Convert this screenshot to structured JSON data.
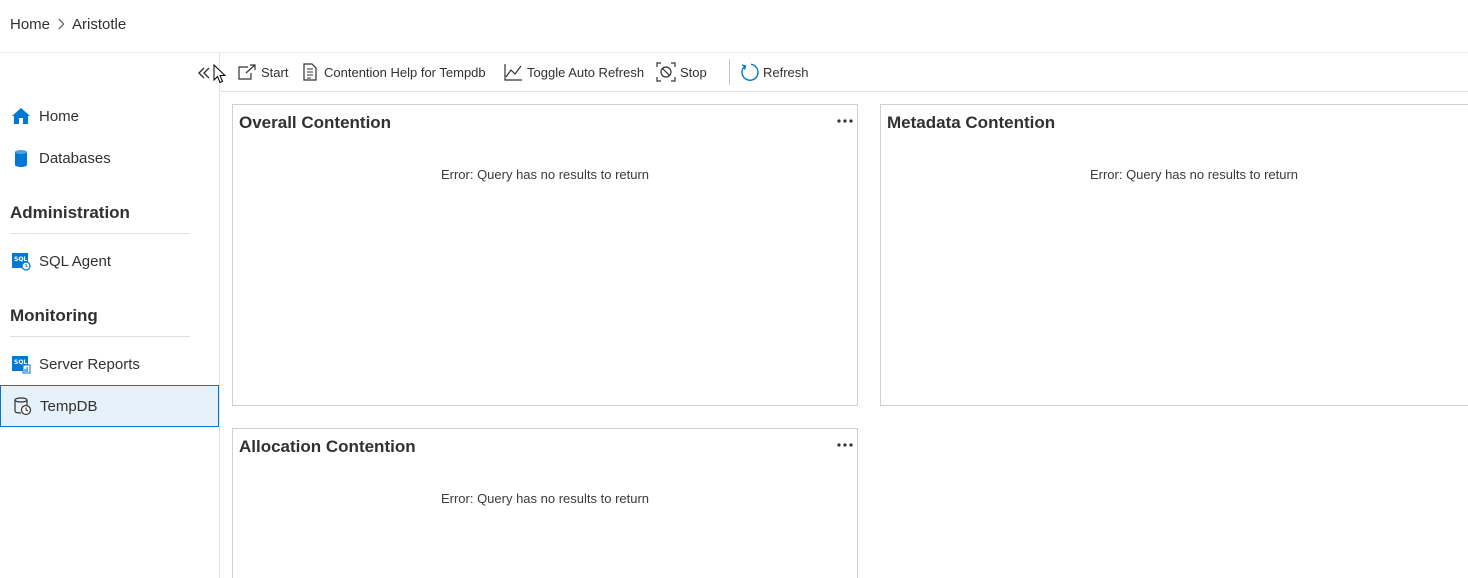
{
  "breadcrumb": {
    "home": "Home",
    "current": "Aristotle"
  },
  "sidebar": {
    "items": [
      {
        "label": "Home",
        "icon": "home-icon"
      },
      {
        "label": "Databases",
        "icon": "database-icon"
      }
    ],
    "sections": [
      {
        "title": "Administration",
        "items": [
          {
            "label": "SQL Agent",
            "icon": "sql-agent-icon"
          }
        ]
      },
      {
        "title": "Monitoring",
        "items": [
          {
            "label": "Server Reports",
            "icon": "server-reports-icon"
          },
          {
            "label": "TempDB",
            "icon": "tempdb-icon",
            "selected": true
          }
        ]
      }
    ]
  },
  "toolbar": {
    "start": "Start",
    "contention_help": "Contention Help for Tempdb",
    "toggle_auto_refresh": "Toggle Auto Refresh",
    "stop": "Stop",
    "refresh": "Refresh"
  },
  "widgets": [
    {
      "title": "Overall Contention",
      "message": "Error: Query has no results to return"
    },
    {
      "title": "Metadata Contention",
      "message": "Error: Query has no results to return"
    },
    {
      "title": "Allocation Contention",
      "message": "Error: Query has no results to return"
    }
  ],
  "colors": {
    "accent": "#0078d4",
    "selected_bg": "#e6f2fb",
    "text": "#323130",
    "border": "#d2d0ce"
  }
}
